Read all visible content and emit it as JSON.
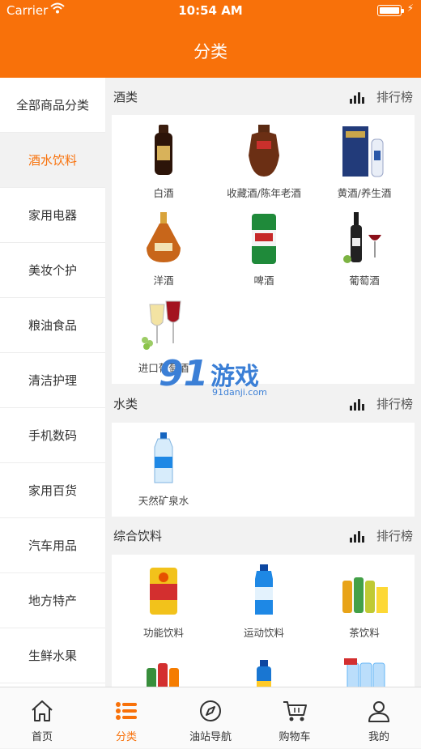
{
  "status": {
    "carrier": "Carrier",
    "time": "10:54 AM"
  },
  "nav": {
    "title": "分类"
  },
  "sidebar": {
    "items": [
      {
        "label": "全部商品分类",
        "active": false
      },
      {
        "label": "酒水饮料",
        "active": true
      },
      {
        "label": "家用电器",
        "active": false
      },
      {
        "label": "美妆个护",
        "active": false
      },
      {
        "label": "粮油食品",
        "active": false
      },
      {
        "label": "清洁护理",
        "active": false
      },
      {
        "label": "手机数码",
        "active": false
      },
      {
        "label": "家用百货",
        "active": false
      },
      {
        "label": "汽车用品",
        "active": false
      },
      {
        "label": "地方特产",
        "active": false
      },
      {
        "label": "生鲜水果",
        "active": false
      }
    ]
  },
  "sections": [
    {
      "title": "酒类",
      "rank_label": "排行榜",
      "items": [
        "白酒",
        "收藏酒/陈年老酒",
        "黄酒/养生酒",
        "洋酒",
        "啤酒",
        "葡萄酒",
        "进口葡萄酒"
      ]
    },
    {
      "title": "水类",
      "rank_label": "排行榜",
      "items": [
        "天然矿泉水"
      ]
    },
    {
      "title": "综合饮料",
      "rank_label": "排行榜",
      "items": [
        "功能饮料",
        "运动饮料",
        "茶饮料"
      ]
    }
  ],
  "watermark": {
    "number": "91",
    "text": "游戏",
    "url": "91danji.com"
  },
  "tabbar": {
    "items": [
      {
        "label": "首页",
        "icon": "home-icon",
        "active": false
      },
      {
        "label": "分类",
        "icon": "category-list-icon",
        "active": true
      },
      {
        "label": "油站导航",
        "icon": "compass-icon",
        "active": false
      },
      {
        "label": "购物车",
        "icon": "cart-icon",
        "active": false
      },
      {
        "label": "我的",
        "icon": "user-icon",
        "active": false
      }
    ]
  },
  "colors": {
    "accent": "#f8710a",
    "background": "#f2f2f2"
  }
}
